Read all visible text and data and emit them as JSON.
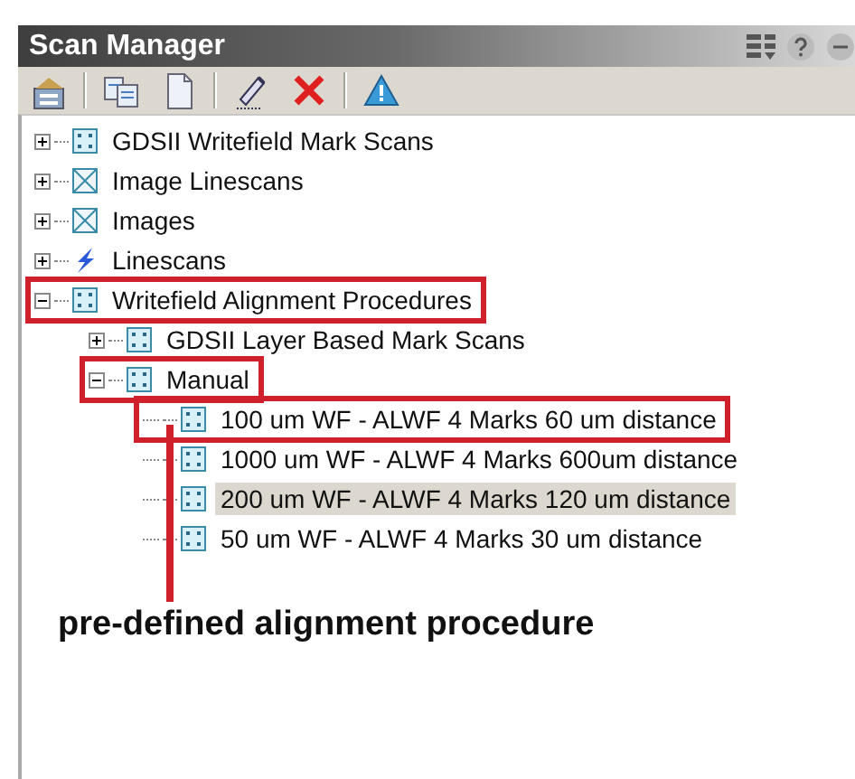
{
  "window": {
    "title": "Scan Manager"
  },
  "title_icons": [
    {
      "kind": "columns"
    },
    {
      "kind": "help"
    },
    {
      "kind": "circle"
    }
  ],
  "toolbar": [
    {
      "kind": "properties"
    },
    {
      "kind": "separator"
    },
    {
      "kind": "copy"
    },
    {
      "kind": "page"
    },
    {
      "kind": "separator"
    },
    {
      "kind": "pen"
    },
    {
      "kind": "delete"
    },
    {
      "kind": "separator"
    },
    {
      "kind": "warning"
    }
  ],
  "tree": [
    {
      "label": "GDSII Writefield Mark Scans",
      "kind": "dots",
      "expanded": false,
      "selected": false,
      "highlighted": false
    },
    {
      "label": "Image Linescans",
      "kind": "cross",
      "expanded": false,
      "selected": false,
      "highlighted": false
    },
    {
      "label": "Images",
      "kind": "cross",
      "expanded": false,
      "selected": false,
      "highlighted": false
    },
    {
      "label": "Linescans",
      "kind": "bolt",
      "expanded": false,
      "selected": false,
      "highlighted": false
    },
    {
      "label": "Writefield Alignment Procedures",
      "kind": "dots",
      "expanded": true,
      "selected": false,
      "highlighted": true,
      "children": [
        {
          "label": "GDSII Layer Based Mark Scans",
          "kind": "dots",
          "expanded": false,
          "selected": false,
          "highlighted": false
        },
        {
          "label": "Manual",
          "kind": "dots",
          "expanded": true,
          "selected": false,
          "highlighted": true,
          "children": [
            {
              "label": "100 um WF - ALWF 4 Marks 60 um distance",
              "kind": "dots",
              "selected": false,
              "highlighted": true
            },
            {
              "label": "1000 um WF - ALWF 4 Marks 600um distance",
              "kind": "dots",
              "selected": false,
              "highlighted": false
            },
            {
              "label": "200 um WF - ALWF 4 Marks 120 um distance",
              "kind": "dots",
              "selected": true,
              "highlighted": false
            },
            {
              "label": "50 um WF - ALWF 4 Marks 30 um distance",
              "kind": "dots",
              "selected": false,
              "highlighted": false
            }
          ]
        }
      ]
    }
  ],
  "annotation": {
    "text": "pre-defined alignment procedure"
  }
}
